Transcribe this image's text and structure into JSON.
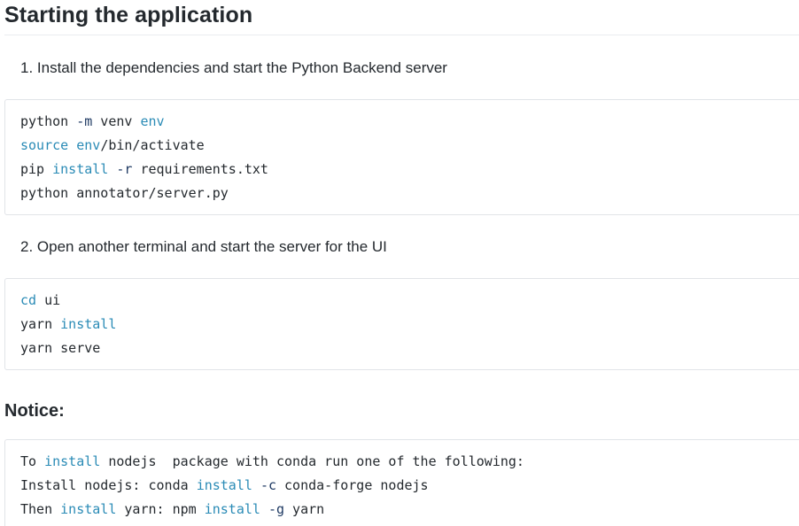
{
  "heading": "Starting the application",
  "steps": [
    {
      "label": "1. Install the dependencies and start the Python Backend server",
      "code": [
        [
          {
            "t": "python ",
            "c": "tx"
          },
          {
            "t": "-m",
            "c": "fl"
          },
          {
            "t": " venv ",
            "c": "tx"
          },
          {
            "t": "env",
            "c": "kw"
          }
        ],
        [
          {
            "t": "source",
            "c": "kw"
          },
          {
            "t": " ",
            "c": "tx"
          },
          {
            "t": "env",
            "c": "kw"
          },
          {
            "t": "/bin/activate",
            "c": "tx"
          }
        ],
        [
          {
            "t": "pip ",
            "c": "tx"
          },
          {
            "t": "install",
            "c": "kw"
          },
          {
            "t": " ",
            "c": "tx"
          },
          {
            "t": "-r",
            "c": "fl"
          },
          {
            "t": " requirements.txt",
            "c": "tx"
          }
        ],
        [
          {
            "t": "python annotator/server.py",
            "c": "tx"
          }
        ]
      ]
    },
    {
      "label": "2. Open another terminal and start the server for the UI",
      "code": [
        [
          {
            "t": "cd",
            "c": "kw"
          },
          {
            "t": " ui",
            "c": "tx"
          }
        ],
        [
          {
            "t": "yarn ",
            "c": "tx"
          },
          {
            "t": "install",
            "c": "kw"
          }
        ],
        [
          {
            "t": "yarn serve",
            "c": "tx"
          }
        ]
      ]
    }
  ],
  "notice": {
    "heading": "Notice:",
    "code": [
      [
        {
          "t": "To ",
          "c": "tx"
        },
        {
          "t": "install",
          "c": "kw"
        },
        {
          "t": " nodejs  package with conda run one of the following:",
          "c": "tx"
        }
      ],
      [
        {
          "t": "Install nodejs: conda ",
          "c": "tx"
        },
        {
          "t": "install",
          "c": "kw"
        },
        {
          "t": " ",
          "c": "tx"
        },
        {
          "t": "-c",
          "c": "fl"
        },
        {
          "t": " conda-forge nodejs",
          "c": "tx"
        }
      ],
      [
        {
          "t": "Then ",
          "c": "tx"
        },
        {
          "t": "install",
          "c": "kw"
        },
        {
          "t": " yarn: npm ",
          "c": "tx"
        },
        {
          "t": "install",
          "c": "kw"
        },
        {
          "t": " ",
          "c": "tx"
        },
        {
          "t": "-g",
          "c": "fl"
        },
        {
          "t": " yarn",
          "c": "tx"
        }
      ]
    ]
  }
}
